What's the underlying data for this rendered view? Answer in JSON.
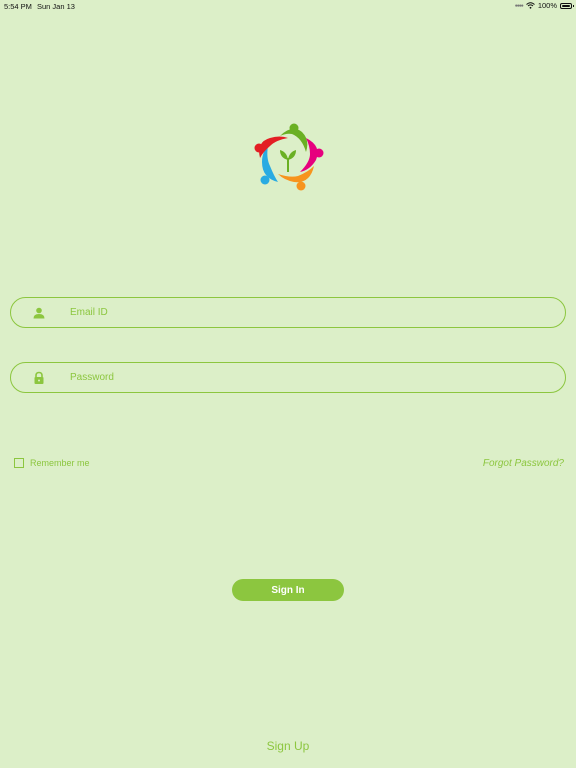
{
  "status_bar": {
    "time": "5:54 PM",
    "date": "Sun Jan 13",
    "battery_percent": "100%",
    "icons": [
      "signal-icon",
      "wifi-icon",
      "battery-icon"
    ]
  },
  "logo": {
    "icon": "people-circle-sprout-logo",
    "colors": [
      "#e31e24",
      "#e6007e",
      "#f7941d",
      "#29abe2",
      "#6ab023"
    ]
  },
  "login": {
    "email_placeholder": "Email ID",
    "email_value": "",
    "email_icon": "user-icon",
    "password_placeholder": "Password",
    "password_value": "",
    "password_icon": "lock-icon",
    "remember_label": "Remember me",
    "remember_checked": false,
    "forgot_label": "Forgot Password?",
    "sign_in_label": "Sign In",
    "sign_up_label": "Sign Up"
  },
  "theme": {
    "background": "#dcefc8",
    "accent": "#8cc63f"
  }
}
